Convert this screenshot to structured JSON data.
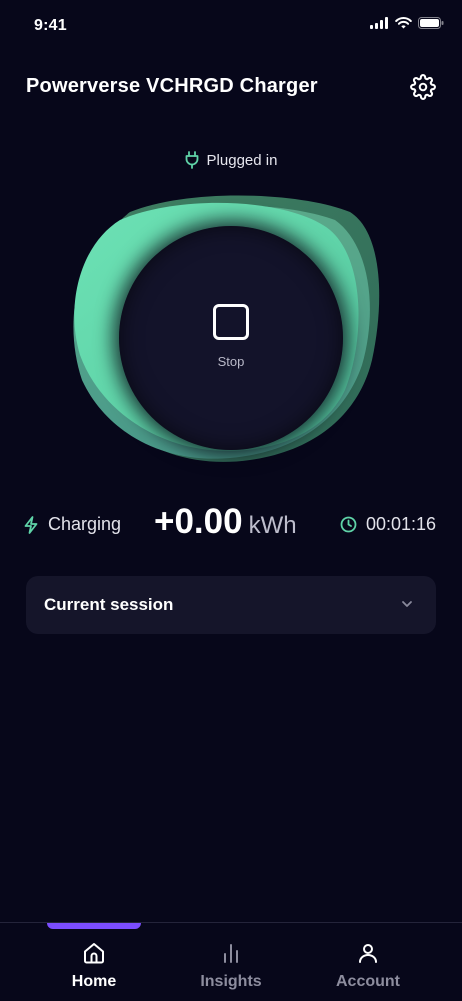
{
  "status_bar": {
    "time": "9:41"
  },
  "header": {
    "title": "Powerverse VCHRGD Charger",
    "settings_icon": "gear-icon"
  },
  "plug": {
    "label": "Plugged in",
    "icon": "plug-icon"
  },
  "control": {
    "stop_label": "Stop"
  },
  "stats": {
    "state_label": "Charging",
    "energy_value": "+0.00",
    "energy_unit": "kWh",
    "elapsed": "00:01:16"
  },
  "session": {
    "title": "Current session"
  },
  "colors": {
    "accent": "#5fd3a8",
    "background": "#07071a",
    "tab_indicator": "#7b4dff",
    "card": "#15152a"
  },
  "tabs": [
    {
      "label": "Home",
      "icon": "home-icon",
      "active": true
    },
    {
      "label": "Insights",
      "icon": "bar-chart-icon",
      "active": false
    },
    {
      "label": "Account",
      "icon": "person-icon",
      "active": false
    }
  ]
}
